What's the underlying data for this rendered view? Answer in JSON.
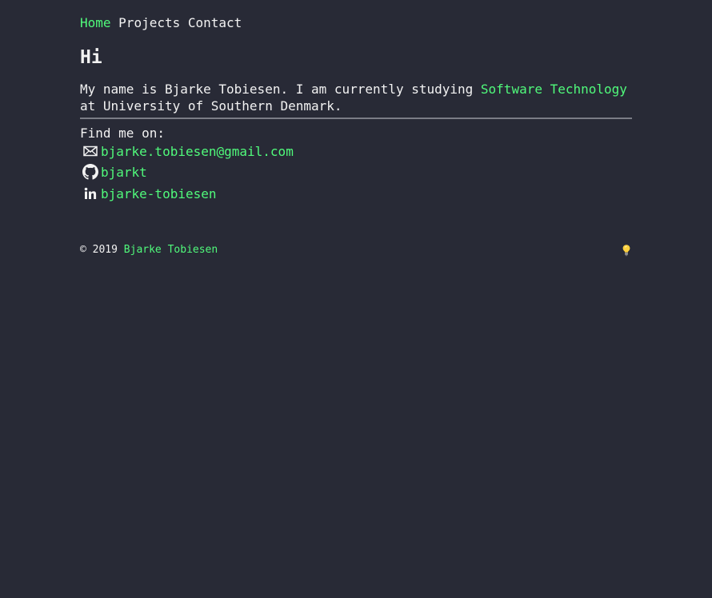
{
  "nav": {
    "items": [
      {
        "label": "Home",
        "active": true
      },
      {
        "label": "Projects",
        "active": false
      },
      {
        "label": "Contact",
        "active": false
      }
    ]
  },
  "heading": "Hi",
  "intro": {
    "before": "My name is Bjarke Tobiesen. I am currently studying ",
    "link": "Software Technology",
    "after": " at University of Southern Denmark."
  },
  "find_label": "Find me on:",
  "contacts": [
    {
      "icon": "mail-icon",
      "label": "bjarke.tobiesen@gmail.com"
    },
    {
      "icon": "github-icon",
      "label": "bjarkt"
    },
    {
      "icon": "linkedin-icon",
      "label": "bjarke-tobiesen"
    }
  ],
  "footer": {
    "copyright": "© 2019 ",
    "author": "Bjarke Tobiesen",
    "theme_icon": "lightbulb-icon"
  },
  "colors": {
    "background": "#282a36",
    "accent": "#50fa7b",
    "text": "#f2f2f2"
  }
}
